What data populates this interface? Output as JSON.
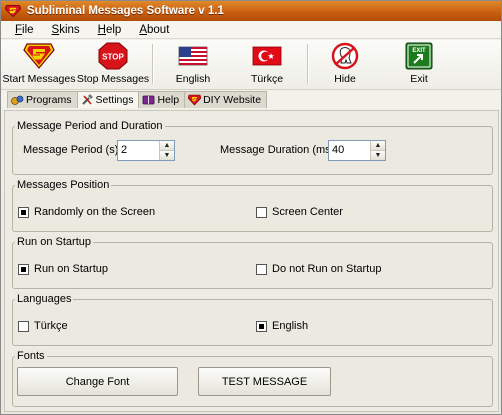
{
  "window": {
    "title": "Subliminal Messages Software v 1.1"
  },
  "menu": [
    {
      "label": "File",
      "hotkey": "F",
      "rest": "ile"
    },
    {
      "label": "Skins",
      "hotkey": "S",
      "rest": "kins"
    },
    {
      "label": "Help",
      "hotkey": "H",
      "rest": "elp"
    },
    {
      "label": "About",
      "hotkey": "A",
      "rest": "bout"
    }
  ],
  "toolbar": {
    "start": "Start Messages",
    "stop": "Stop Messages",
    "stop_sign_text": "STOP",
    "english": "English",
    "turkce": "Türkçe",
    "hide": "Hide",
    "exit": "Exit",
    "exit_sign_text": "EXIT"
  },
  "tabs": [
    {
      "label": "Programs",
      "icon": "programs-icon"
    },
    {
      "label": "Settings",
      "icon": "settings-icon",
      "active": true
    },
    {
      "label": "Help",
      "icon": "book-icon"
    },
    {
      "label": "DIY  Website",
      "icon": "superman-icon"
    }
  ],
  "period": {
    "group_label": "Message Period and Duration",
    "period_label": "Message Period (s)",
    "period_value": "2",
    "duration_label": "Message Duration (ms)",
    "duration_value": "40"
  },
  "position": {
    "group_label": "Messages Position",
    "random_label": "Randomly on the Screen",
    "random_checked": true,
    "center_label": "Screen Center",
    "center_checked": false
  },
  "startup": {
    "group_label": "Run on Startup",
    "run_label": "Run on Startup",
    "run_checked": true,
    "norun_label": "Do not Run on Startup",
    "norun_checked": false
  },
  "languages": {
    "group_label": "Languages",
    "turkce_label": "Türkçe",
    "turkce_checked": false,
    "english_label": "English",
    "english_checked": true
  },
  "fonts": {
    "group_label": "Fonts",
    "change_font": "Change Font",
    "test_message": "TEST MESSAGE"
  },
  "colors": {
    "titlebar": "#c8600f",
    "superman_red": "#d8141b",
    "superman_yellow": "#f5d200",
    "exit_green": "#1d7a1d"
  }
}
